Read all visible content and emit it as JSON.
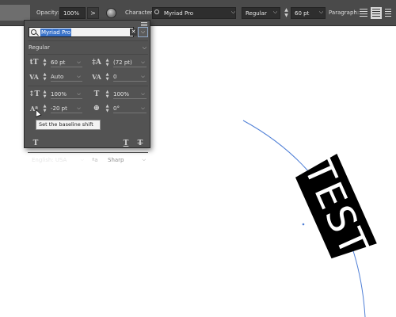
{
  "control_bar": {
    "opacity_label": "Opacity:",
    "opacity_value": "100%",
    "expand_glyph": ">",
    "character_label": "Character:",
    "font_family": "Myriad Pro",
    "font_style": "Regular",
    "font_size": "60 pt",
    "paragraph_label": "Paragraph:"
  },
  "character_panel": {
    "font_search_value": "Myriad Pro",
    "clear_glyph": "✕",
    "font_style": "Regular",
    "font_size": "60 pt",
    "leading": "(72 pt)",
    "kerning": "Auto",
    "tracking": "0",
    "vertical_scale": "100%",
    "horizontal_scale": "100%",
    "baseline_shift": "-20 pt",
    "character_rotation": "0°",
    "tooltip": "Set the baseline shift",
    "language": "English: USA",
    "anti_aliasing_icon": "ªa",
    "anti_aliasing": "Sharp"
  },
  "artboard": {
    "text_on_path": "TEST"
  },
  "colors": {
    "panel_bg": "#535353",
    "toolbar_bg": "#4a4a4a",
    "selection": "#3a73c9",
    "path_stroke": "#4f7fd6"
  }
}
